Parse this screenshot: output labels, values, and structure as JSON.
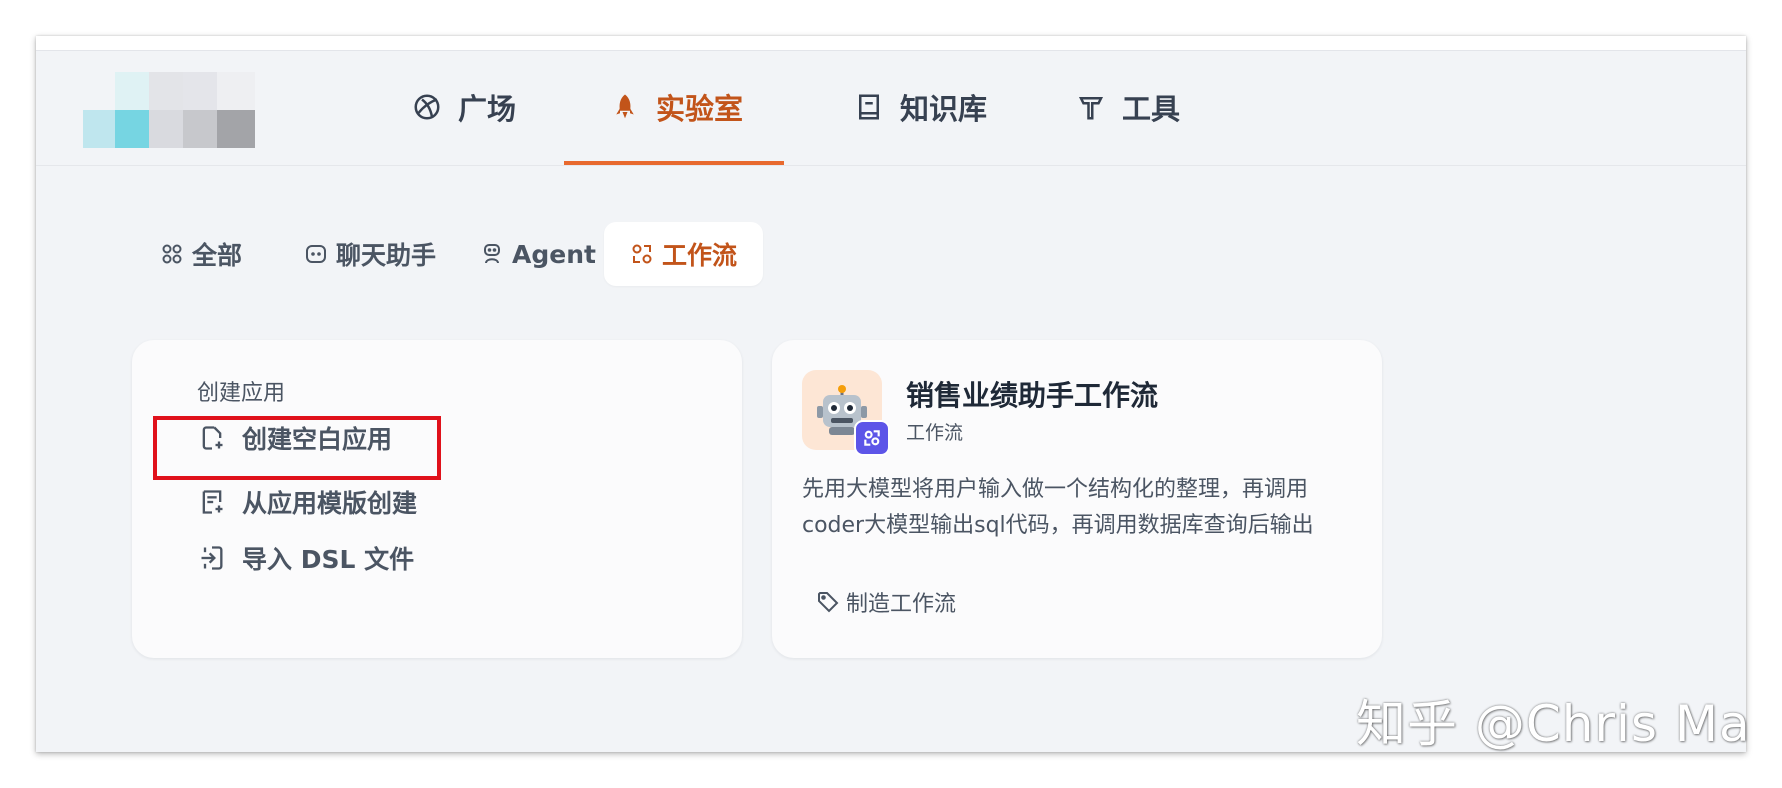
{
  "nav": {
    "items": [
      {
        "label": "广场",
        "icon": "compass-icon"
      },
      {
        "label": "实验室",
        "icon": "rocket-icon",
        "active": true
      },
      {
        "label": "知识库",
        "icon": "book-icon"
      },
      {
        "label": "工具",
        "icon": "hammer-icon"
      }
    ]
  },
  "tabs": [
    {
      "label": "全部",
      "icon": "grid-icon"
    },
    {
      "label": "聊天助手",
      "icon": "chat-bubble-icon"
    },
    {
      "label": "Agent",
      "icon": "robot-icon"
    },
    {
      "label": "工作流",
      "icon": "workflow-icon",
      "active": true
    }
  ],
  "create_card": {
    "title": "创建应用",
    "items": [
      {
        "label": "创建空白应用",
        "icon": "file-plus-icon"
      },
      {
        "label": "从应用模版创建",
        "icon": "file-template-icon"
      },
      {
        "label": "导入 DSL 文件",
        "icon": "import-icon"
      }
    ]
  },
  "app_card": {
    "name": "销售业绩助手工作流",
    "type": "工作流",
    "avatar": "robot-emoji",
    "description": "先用大模型将用户输入做一个结构化的整理，再调用coder大模型输出sql代码，再调用数据库查询后输出",
    "tag": "制造工作流"
  },
  "watermark": "知乎 @Chris Ma",
  "colors": {
    "accent": "#c2541a",
    "underline": "#e8692e",
    "highlight": "#e0111b",
    "badge": "#5d55e8",
    "background": "#f2f4f7"
  }
}
